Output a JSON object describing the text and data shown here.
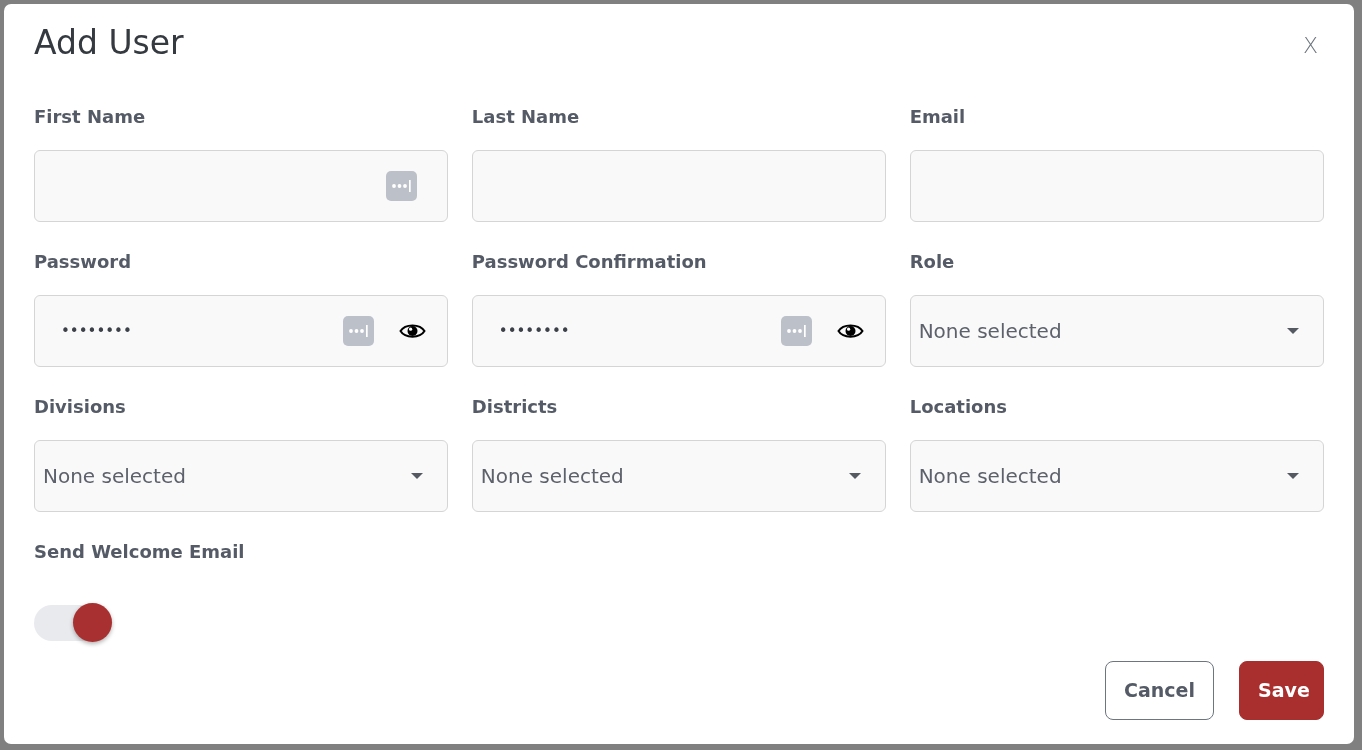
{
  "dialog": {
    "title": "Add User",
    "close_label": "X"
  },
  "fields": [
    {
      "label": "First Name",
      "kind": "text",
      "password_manager": true
    },
    {
      "label": "Last Name",
      "kind": "text",
      "password_manager": false
    },
    {
      "label": "Email",
      "kind": "text",
      "password_manager": false
    },
    {
      "label": "Password",
      "kind": "password",
      "value": "••••••••",
      "password_manager": true
    },
    {
      "label": "Password Confirmation",
      "kind": "password",
      "value": "••••••••",
      "password_manager": true
    },
    {
      "label": "Role",
      "kind": "select",
      "value": "None selected"
    },
    {
      "label": "Divisions",
      "kind": "select",
      "value": "None selected"
    },
    {
      "label": "Districts",
      "kind": "select",
      "value": "None selected"
    },
    {
      "label": "Locations",
      "kind": "select",
      "value": "None selected"
    },
    {
      "label": "Send Welcome Email",
      "kind": "toggle",
      "on": true
    }
  ],
  "buttons": [
    {
      "label": "Cancel",
      "kind": "outline"
    },
    {
      "label": "Save",
      "kind": "primary"
    }
  ]
}
